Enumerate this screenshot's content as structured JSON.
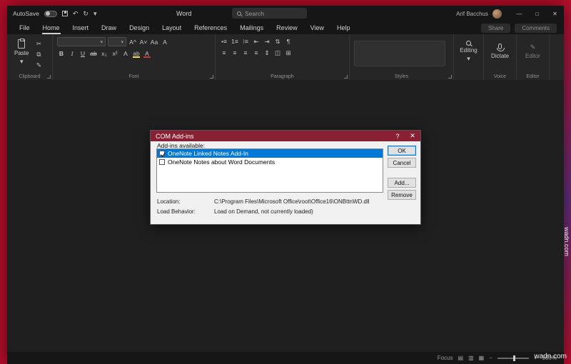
{
  "titlebar": {
    "autosave": "AutoSave",
    "title": "Word",
    "search": "Search",
    "user": "Arif Bacchus"
  },
  "icons": {
    "undo": "↶",
    "redo": "↻",
    "dropdown": "▾",
    "minimize": "—",
    "maximize": "□",
    "close": "✕",
    "help": "?",
    "cut": "✂",
    "copy": "⧉",
    "painter": "✎",
    "pencil": "✎"
  },
  "menubar": {
    "tabs": [
      "File",
      "Home",
      "Insert",
      "Draw",
      "Design",
      "Layout",
      "References",
      "Mailings",
      "Review",
      "View",
      "Help"
    ],
    "active_tab": "Home",
    "share": "Share",
    "comments": "Comments"
  },
  "ribbon": {
    "paste": "Paste",
    "font_row1": [
      "A^",
      "A˅",
      "Aa",
      "A"
    ],
    "font_row2": [
      "B",
      "I",
      "U",
      "ab",
      "x₂",
      "x²",
      "A",
      "ab",
      "A"
    ],
    "para_row1": [
      "•≡",
      "1≡",
      "⁝≡",
      "⇤",
      "⇥",
      "⇅",
      "¶"
    ],
    "para_row2": [
      "≡",
      "≡",
      "≡",
      "≡",
      "⇕",
      "◫",
      "⊞"
    ],
    "editing": "Editing",
    "dictate": "Dictate",
    "editor_button": "Editor",
    "labels": {
      "clipboard": "Clipboard",
      "font": "Font",
      "paragraph": "Paragraph",
      "styles": "Styles",
      "voice": "Voice",
      "editor": "Editor"
    }
  },
  "statusbar": {
    "focus": "Focus",
    "views": [
      "▤",
      "▥",
      "▦"
    ],
    "zoom_out": "−",
    "zoom_in": "+",
    "zoom_level": "100%"
  },
  "dialog": {
    "title": "COM Add-ins",
    "available_label": "Add-ins available:",
    "items": [
      {
        "label": "OneNote Linked Notes Add-In",
        "checked": true,
        "selected": true
      },
      {
        "label": "OneNote Notes about Word Documents",
        "checked": false,
        "selected": false
      }
    ],
    "ok": "OK",
    "cancel": "Cancel",
    "add": "Add...",
    "remove": "Remove",
    "location_label": "Location:",
    "location_value": "C:\\Program Files\\Microsoft Office\\root\\Office16\\ONBttnWD.dll",
    "behavior_label": "Load Behavior:",
    "behavior_value": "Load on Demand, not currently loaded)"
  },
  "watermark": "wadn.com"
}
